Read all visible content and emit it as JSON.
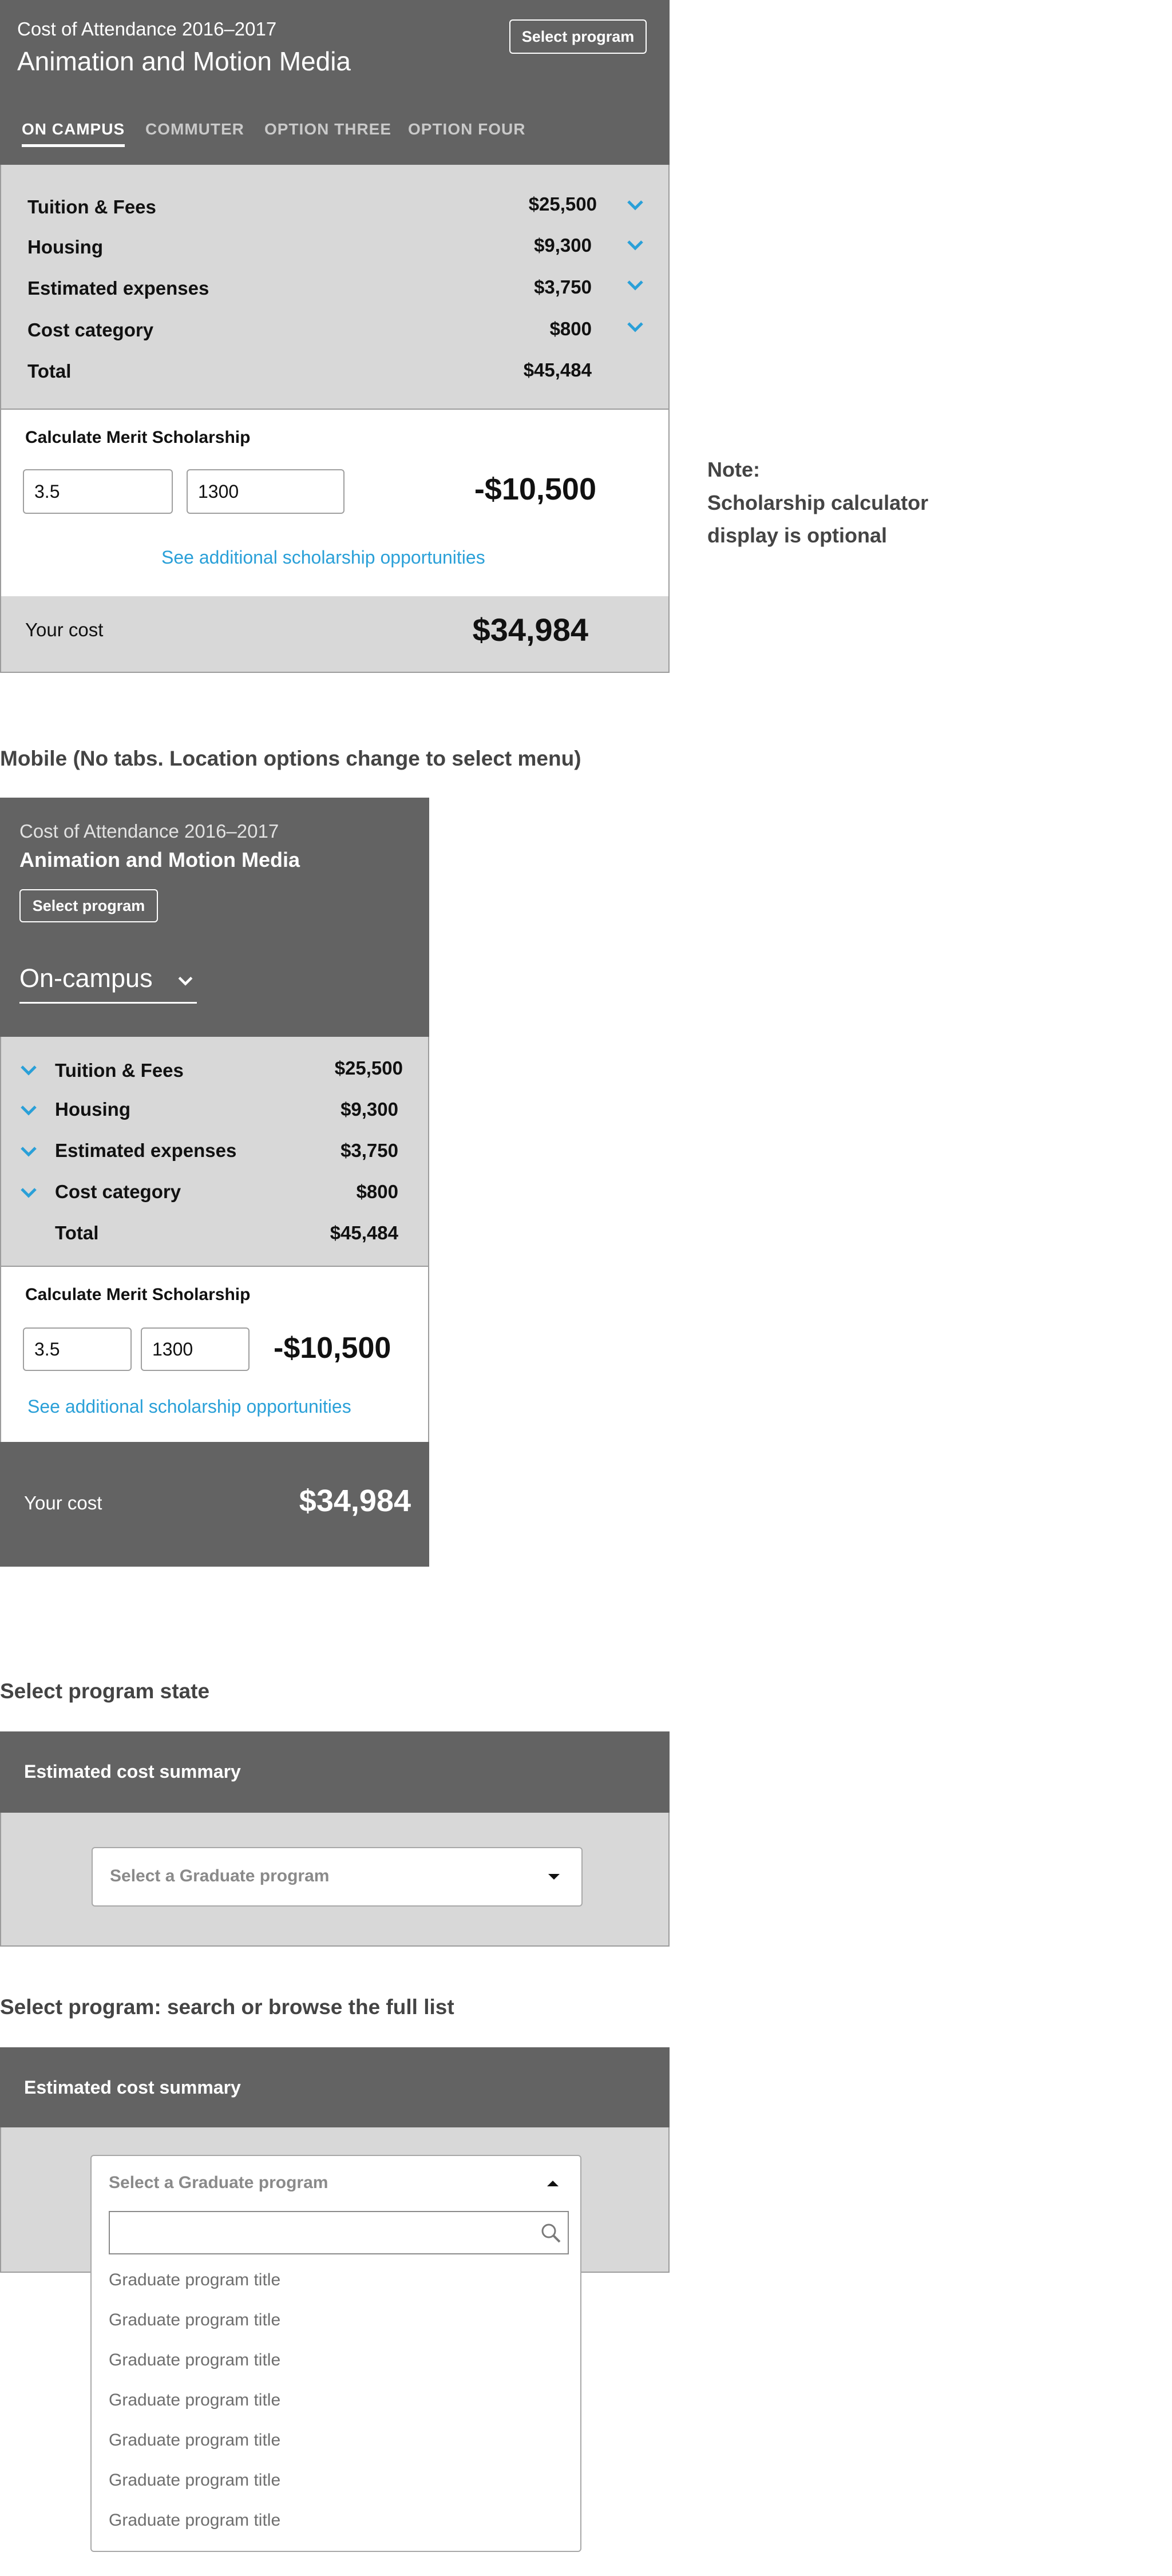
{
  "desktop": {
    "header": {
      "subtitle": "Cost of Attendance 2016–2017",
      "title": "Animation and Motion Media",
      "select_button": "Select program"
    },
    "tabs": [
      "ON CAMPUS",
      "COMMUTER",
      "OPTION THREE",
      "OPTION FOUR"
    ],
    "rows": [
      {
        "label": "Tuition & Fees",
        "value": "$25,500"
      },
      {
        "label": "Housing",
        "value": "$9,300"
      },
      {
        "label": "Estimated expenses",
        "value": "$3,750"
      },
      {
        "label": "Cost category",
        "value": "$800"
      }
    ],
    "total": {
      "label": "Total",
      "value": "$45,484"
    },
    "scholarship": {
      "title": "Calculate Merit Scholarship",
      "gpa": "3.5",
      "score": "1300",
      "amount": "-$10,500",
      "link": "See additional scholarship opportunities"
    },
    "your_cost": {
      "label": "Your cost",
      "value": "$34,984"
    }
  },
  "note": {
    "line1": "Note:",
    "line2": "Scholarship calculator",
    "line3": "display is optional"
  },
  "mobile_heading": "Mobile (No tabs. Location options change to select menu)",
  "mobile": {
    "header": {
      "subtitle": "Cost of Attendance 2016–2017",
      "title": "Animation and Motion Media",
      "select_button": "Select program",
      "location": "On-campus"
    },
    "rows": [
      {
        "label": "Tuition & Fees",
        "value": "$25,500"
      },
      {
        "label": "Housing",
        "value": "$9,300"
      },
      {
        "label": "Estimated expenses",
        "value": "$3,750"
      },
      {
        "label": "Cost category",
        "value": "$800"
      }
    ],
    "total": {
      "label": "Total",
      "value": "$45,484"
    },
    "scholarship": {
      "title": "Calculate Merit Scholarship",
      "gpa": "3.5",
      "score": "1300",
      "amount": "-$10,500",
      "link": "See additional scholarship opportunities"
    },
    "your_cost": {
      "label": "Your cost",
      "value": "$34,984"
    }
  },
  "select_state": {
    "heading": "Select program state",
    "panel_title": "Estimated cost summary",
    "dropdown_placeholder": "Select a Graduate program"
  },
  "search_state": {
    "heading": "Select program: search or browse the full list",
    "panel_title": "Estimated cost summary",
    "dropdown_placeholder": "Select a Graduate program",
    "search_value": "",
    "items": [
      "Graduate program title",
      "Graduate program title",
      "Graduate program title",
      "Graduate program title",
      "Graduate program title",
      "Graduate program title",
      "Graduate program title"
    ]
  },
  "colors": {
    "header_bg": "#636363",
    "body_bg": "#d8d8d8",
    "accent": "#2aa0d8"
  }
}
